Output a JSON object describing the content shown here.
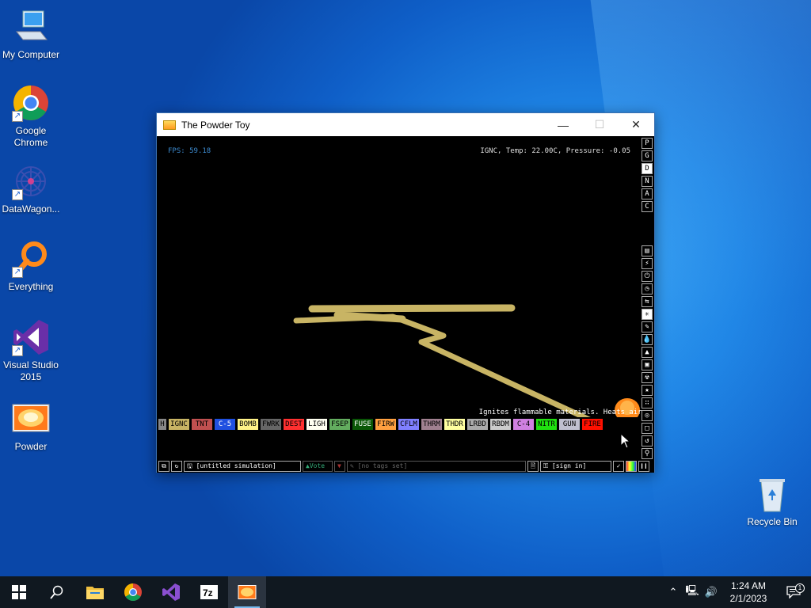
{
  "desktop": {
    "icons": [
      {
        "label": "My Computer",
        "icon": "computer-icon"
      },
      {
        "label": "Google Chrome",
        "icon": "chrome-icon"
      },
      {
        "label": "DataWagon...",
        "icon": "datawagon-icon"
      },
      {
        "label": "Everything",
        "icon": "everything-search-icon"
      },
      {
        "label": "Visual Studio 2015",
        "icon": "visual-studio-icon"
      },
      {
        "label": "Powder",
        "icon": "powder-toy-icon"
      },
      {
        "label": "Recycle Bin",
        "icon": "recycle-bin-icon"
      }
    ]
  },
  "window": {
    "title": "The Powder Toy",
    "fps": "FPS: 59.18",
    "hud": "IGNC, Temp: 22.00C, Pressure: -0.05",
    "tooltip": "Ignites flammable materials. Heats air.",
    "display_modes": [
      "P",
      "G",
      "D",
      "N",
      "A",
      "C"
    ],
    "active_display_mode": "D",
    "elements": [
      {
        "label": "H",
        "bg": "#888888",
        "fg": "#000000"
      },
      {
        "label": "IGNC",
        "bg": "#c8b464",
        "fg": "#000000"
      },
      {
        "label": "TNT",
        "bg": "#c05050",
        "fg": "#000000"
      },
      {
        "label": "C-5",
        "bg": "#2050e0",
        "fg": "#ffffff"
      },
      {
        "label": "BOMB",
        "bg": "#fff288",
        "fg": "#000000"
      },
      {
        "label": "FWRK",
        "bg": "#666666",
        "fg": "#000000"
      },
      {
        "label": "DEST",
        "bg": "#ff3030",
        "fg": "#000000"
      },
      {
        "label": "LIGH",
        "bg": "#fffff0",
        "fg": "#000000"
      },
      {
        "label": "FSEP",
        "bg": "#63ad5f",
        "fg": "#000000"
      },
      {
        "label": "FUSE",
        "bg": "#0a5706",
        "fg": "#ffffff"
      },
      {
        "label": "FIRW",
        "bg": "#ffa040",
        "fg": "#000000"
      },
      {
        "label": "CFLM",
        "bg": "#8080ff",
        "fg": "#000000"
      },
      {
        "label": "THRM",
        "bg": "#a08090",
        "fg": "#000000"
      },
      {
        "label": "THDR",
        "bg": "#ffffa0",
        "fg": "#000000"
      },
      {
        "label": "LRBD",
        "bg": "#aaaaaa",
        "fg": "#000000"
      },
      {
        "label": "RBDM",
        "bg": "#cccccc",
        "fg": "#000000"
      },
      {
        "label": "C-4",
        "bg": "#d080e0",
        "fg": "#000000"
      },
      {
        "label": "NITR",
        "bg": "#20e010",
        "fg": "#000000"
      },
      {
        "label": "GUN",
        "bg": "#c0c0d0",
        "fg": "#000000"
      },
      {
        "label": "FIRE",
        "bg": "#ff1000",
        "fg": "#000000"
      }
    ],
    "bottom": {
      "save_name": "[untitled simulation]",
      "vote": "Vote",
      "tags": "[no tags set]",
      "sign_in": "[sign in]"
    }
  },
  "taskbar": {
    "pinned": [
      "windows-start-icon",
      "search-icon",
      "file-explorer-icon",
      "chrome-icon",
      "visual-studio-icon",
      "7zip-icon",
      "powder-toy-icon"
    ],
    "time": "1:24 AM",
    "date": "2/1/2023",
    "notification_count": "1",
    "colors": {
      "taskbar": "#101820",
      "accent": "#76b9ed"
    }
  }
}
